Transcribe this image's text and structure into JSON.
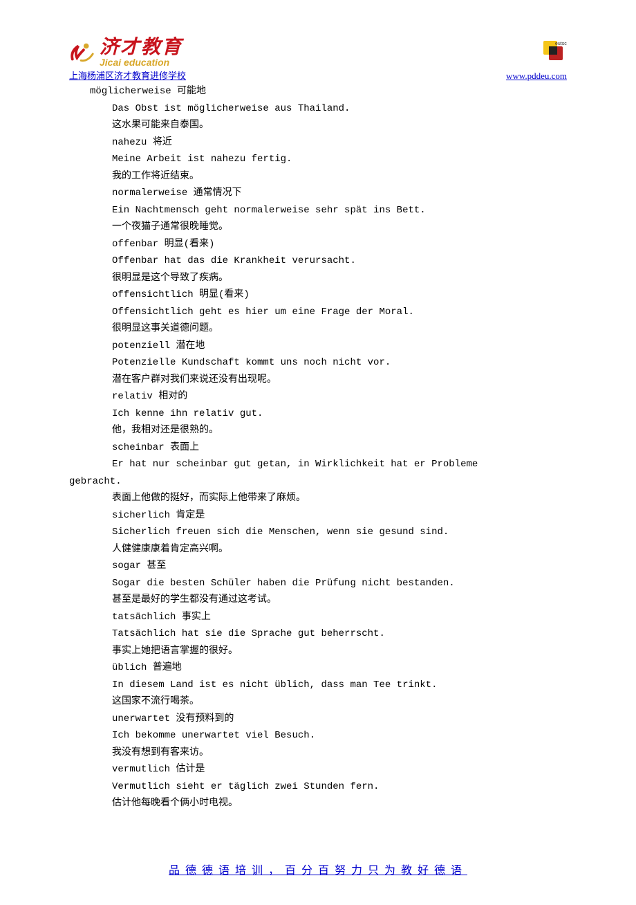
{
  "header": {
    "logo_cn": "济才教育",
    "logo_en": "Jicai education",
    "link_left": "上海杨浦区济才教育进修学校",
    "link_right": "www.pddeu.com",
    "de_label": "eutsch"
  },
  "lines": [
    {
      "cls": "line-indent-0",
      "text": "möglicherweise 可能地"
    },
    {
      "cls": "line-indent-1",
      "text": "Das Obst ist möglicherweise aus Thailand."
    },
    {
      "cls": "line-indent-1",
      "text": "这水果可能来自泰国。"
    },
    {
      "cls": "line-indent-1",
      "text": "nahezu 将近"
    },
    {
      "cls": "line-indent-1",
      "text": "Meine Arbeit ist nahezu fertig."
    },
    {
      "cls": "line-indent-1",
      "text": "我的工作将近结束。"
    },
    {
      "cls": "line-indent-1",
      "text": "normalerweise 通常情况下"
    },
    {
      "cls": "line-indent-1",
      "text": "Ein Nachtmensch geht normalerweise sehr spät ins Bett."
    },
    {
      "cls": "line-indent-1",
      "text": "一个夜猫子通常很晚睡觉。"
    },
    {
      "cls": "line-indent-1",
      "text": "offenbar 明显(看来)"
    },
    {
      "cls": "line-indent-1",
      "text": "Offenbar hat das die Krankheit verursacht."
    },
    {
      "cls": "line-indent-1",
      "text": "很明显是这个导致了疾病。"
    },
    {
      "cls": "line-indent-1",
      "text": "offensichtlich 明显(看来)"
    },
    {
      "cls": "line-indent-1",
      "text": "Offensichtlich geht es hier um eine Frage der Moral."
    },
    {
      "cls": "line-indent-1",
      "text": "很明显这事关道德问题。"
    },
    {
      "cls": "line-indent-1",
      "text": "potenziell 潜在地"
    },
    {
      "cls": "line-indent-1",
      "text": "Potenzielle Kundschaft kommt uns noch nicht vor."
    },
    {
      "cls": "line-indent-1",
      "text": "潜在客户群对我们来说还没有出现呢。"
    },
    {
      "cls": "line-indent-1",
      "text": "relativ 相对的"
    },
    {
      "cls": "line-indent-1",
      "text": "Ich kenne ihn relativ gut."
    },
    {
      "cls": "line-indent-1",
      "text": "他，我相对还是很熟的。"
    },
    {
      "cls": "line-indent-1",
      "text": "scheinbar 表面上"
    },
    {
      "cls": "line-indent-1",
      "text": "Er hat nur scheinbar gut getan, in Wirklichkeit hat er Probleme"
    },
    {
      "cls": "line-wrap",
      "text": "gebracht."
    },
    {
      "cls": "line-indent-1",
      "text": "表面上他做的挺好，而实际上他带来了麻烦。"
    },
    {
      "cls": "line-indent-1",
      "text": "sicherlich 肯定是"
    },
    {
      "cls": "line-indent-1",
      "text": "Sicherlich freuen sich die Menschen, wenn sie gesund sind."
    },
    {
      "cls": "line-indent-1",
      "text": "人健健康康着肯定高兴啊。"
    },
    {
      "cls": "line-indent-1",
      "text": "sogar 甚至"
    },
    {
      "cls": "line-indent-1",
      "text": "Sogar die besten Schüler haben die Prüfung nicht bestanden."
    },
    {
      "cls": "line-indent-1",
      "text": "甚至是最好的学生都没有通过这考试。"
    },
    {
      "cls": "line-indent-1",
      "text": "tatsächlich 事实上"
    },
    {
      "cls": "line-indent-1",
      "text": "Tatsächlich hat sie die Sprache gut beherrscht."
    },
    {
      "cls": "line-indent-1",
      "text": "事实上她把语言掌握的很好。"
    },
    {
      "cls": "line-indent-1",
      "text": "üblich 普遍地"
    },
    {
      "cls": "line-indent-1",
      "text": "In diesem Land ist es nicht üblich, dass man Tee trinkt."
    },
    {
      "cls": "line-indent-1",
      "text": "这国家不流行喝茶。"
    },
    {
      "cls": "line-indent-1",
      "text": "unerwartet 没有预料到的"
    },
    {
      "cls": "line-indent-1",
      "text": "Ich bekomme unerwartet viel Besuch."
    },
    {
      "cls": "line-indent-1",
      "text": "我没有想到有客来访。"
    },
    {
      "cls": "line-indent-1",
      "text": "vermutlich 估计是"
    },
    {
      "cls": "line-indent-1",
      "text": "Vermutlich sieht er täglich zwei Stunden fern."
    },
    {
      "cls": "line-indent-1",
      "text": "估计他每晚看个俩小时电视。"
    }
  ],
  "footer": "品德德语培训，百分百努力只为教好德语"
}
